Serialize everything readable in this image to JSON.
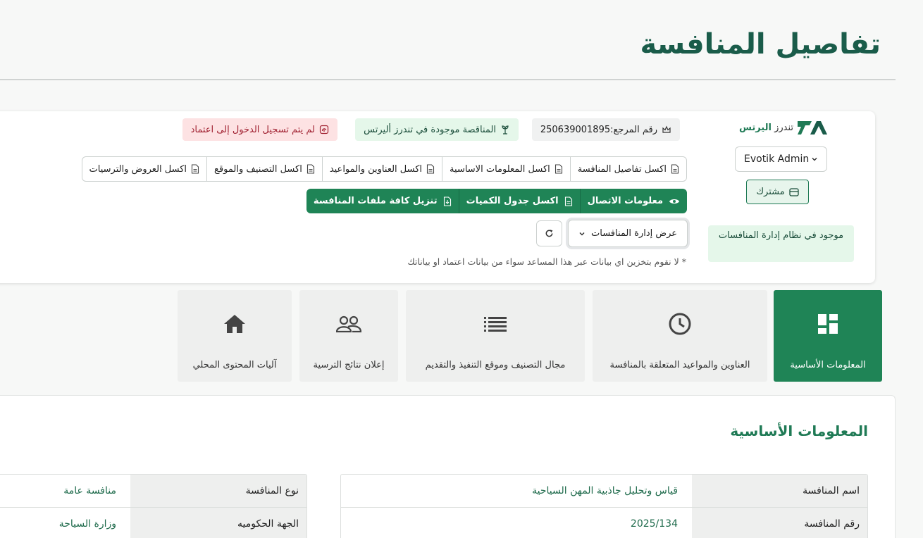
{
  "page": {
    "title": "تفاصيل المنافسة"
  },
  "card": {
    "logo": {
      "prefix": "تندرز",
      "brand": "اليرتس"
    },
    "user": {
      "name": "Evotik Admin"
    },
    "subscribed_label": "مشترك",
    "exists_text": "موجود في نظام إدارة المنافسات",
    "chips": {
      "reference": "رقم المرجع:250639001895",
      "found": "المناقصة موجودة في تندرز أليرتس",
      "login": "لم يتم تسجيل الدخول إلى اعتماد"
    },
    "excel_buttons": [
      {
        "label": "اكسل تفاصيل المنافسة"
      },
      {
        "label": "اكسل المعلومات الاساسية"
      },
      {
        "label": "اكسل العناوين والمواعيد"
      },
      {
        "label": "اكسل التصنيف والموقع"
      },
      {
        "label": "اكسل العروض والترسيات"
      }
    ],
    "green_buttons": [
      {
        "label": "معلومات الاتصال"
      },
      {
        "label": "اكسل جدول الكميات"
      },
      {
        "label": "تنزيل كافة ملفات المنافسة"
      }
    ],
    "view_select": {
      "value": "عرض إدارة المنافسات"
    },
    "note": "* لا نقوم بتخزين اي بيانات عبر هذا المساعد سواء من بيانات اعتماد او بياناتك"
  },
  "tabs": [
    {
      "label": "المعلومات الأساسية",
      "icon": "dashboard-icon",
      "active": true
    },
    {
      "label": "العناوين والمواعيد المتعلقة بالمنافسة",
      "icon": "clock-icon"
    },
    {
      "label": "مجال التصنيف وموقع التنفيذ والتقديم",
      "icon": "list-icon"
    },
    {
      "label": "إعلان نتائج الترسية",
      "icon": "people-icon"
    },
    {
      "label": "آليات المحتوى المحلي",
      "icon": "home-icon"
    }
  ],
  "section": {
    "title": "المعلومات الأساسية",
    "table_right": [
      {
        "key": "اسم المنافسة",
        "value": "قياس وتحليل جاذبية المهن السياحية"
      },
      {
        "key": "رقم المنافسة",
        "value": "2025/134"
      }
    ],
    "table_left": [
      {
        "key": "نوع المنافسة",
        "value": "منافسة عامة"
      },
      {
        "key": "الجهة الحكوميه",
        "value": "وزارة السياحة"
      }
    ]
  },
  "colors": {
    "primary": "#1f8456",
    "title": "#1a5c4a",
    "danger_bg": "#fde2e3",
    "success_bg": "#e5f7ea"
  }
}
